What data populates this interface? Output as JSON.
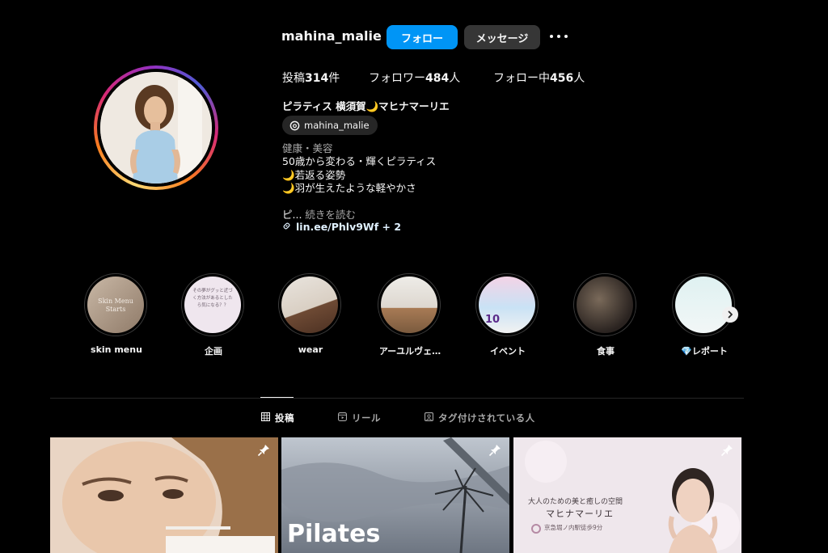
{
  "profile": {
    "username": "mahina_malie",
    "follow_label": "フォロー",
    "message_label": "メッセージ",
    "stats": {
      "posts_prefix": "投稿",
      "posts_count": "314",
      "posts_suffix": "件",
      "followers_prefix": "フォロワー",
      "followers_count": "484",
      "followers_suffix": "人",
      "following_prefix": "フォロー中",
      "following_count": "456",
      "following_suffix": "人"
    },
    "full_name": "ピラティス 横須賀🌙マヒナマーリエ",
    "threads_handle": "mahina_malie",
    "category": "健康・美容",
    "bio_lines": [
      "50歳から変わる・輝くピラティス",
      "🌙若返る姿勢",
      "🌙羽が生えたような軽やかさ"
    ],
    "truncated_text": "ピ...",
    "more_label": "続きを読む",
    "link": "lin.ee/Phlv9Wf + 2"
  },
  "highlights": [
    {
      "label": "skin menu",
      "cover_text": "Skin Menu Starts"
    },
    {
      "label": "企画",
      "cover_text": "その夢がグッと近づく方法があるとしたら気になる？？"
    },
    {
      "label": "wear",
      "cover_text": ""
    },
    {
      "label": "アーユルヴェ…",
      "cover_text": ""
    },
    {
      "label": "イベント",
      "cover_text": "10"
    },
    {
      "label": "食事",
      "cover_text": ""
    },
    {
      "label": "💎レポート",
      "cover_text": ""
    }
  ],
  "tabs": [
    {
      "label": "投稿",
      "icon": "grid-icon",
      "active": true
    },
    {
      "label": "リール",
      "icon": "reels-icon",
      "active": false
    },
    {
      "label": "タグ付けされている人",
      "icon": "tagged-icon",
      "active": false
    }
  ],
  "posts": [
    {
      "caption": "",
      "pinned": true
    },
    {
      "caption": "Pilates",
      "pinned": true
    },
    {
      "caption": "大人のための美と癒しの空間",
      "title": "マヒナマーリエ",
      "location": "京急堀ノ内駅徒歩9分",
      "pinned": true
    }
  ],
  "colors": {
    "background": "#000000",
    "primary_button": "#0095f6",
    "secondary_button": "#363636",
    "muted_text": "#a8a8a8",
    "link_text": "#e0f1ff"
  }
}
